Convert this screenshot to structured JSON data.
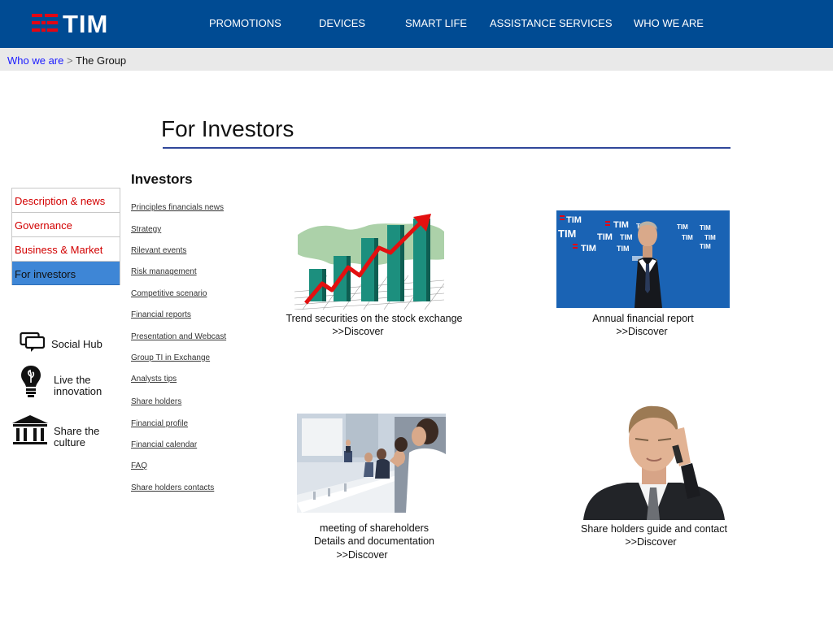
{
  "header": {
    "logo_text": "TIM",
    "brand_color": "#004b93",
    "logo_accent": "#e30613",
    "nav": [
      "PROMOTIONS",
      "DEVICES",
      "SMART LIFE",
      "ASSISTANCE SERVICES",
      "WHO WE ARE"
    ]
  },
  "breadcrumb": {
    "link": "Who we are",
    "separator": ">",
    "current": "The Group"
  },
  "main": {
    "title": "For Investors"
  },
  "leftnav": {
    "items": [
      {
        "label": "Description & news"
      },
      {
        "label": "Governance"
      },
      {
        "label": "Business & Market"
      },
      {
        "label": "For investors",
        "active": true
      }
    ],
    "active_color": "#3e86d6",
    "link_color": "#d20000"
  },
  "social": [
    {
      "label": "Social Hub",
      "icon": "chat-bubbles-icon"
    },
    {
      "label": "Live the\ninnovation",
      "icon": "lightbulb-icon"
    },
    {
      "label": "Share the\n culture",
      "icon": "museum-icon"
    }
  ],
  "investors": {
    "heading": "Investors",
    "links": [
      "Principles financials news",
      "Strategy",
      "Rilevant events",
      "Risk management",
      "Competitive scenario",
      "Financial reports",
      "Presentation and Webcast",
      "Group TI in Exchange",
      "Analysts tips",
      "Share holders",
      "Financial profile",
      "Financial calendar",
      "FAQ",
      "Share holders contacts"
    ]
  },
  "cards": [
    {
      "title": "Trend securities on the stock exchange",
      "discover": ">>Discover",
      "image": "stock-chart-image"
    },
    {
      "title": "Annual financial report",
      "discover": ">>Discover",
      "image": "speaker-photo"
    },
    {
      "title": "meeting of shareholders",
      "subtitle": "Details and documentation",
      "discover": ">>Discover",
      "image": "meeting-photo"
    },
    {
      "title": "Share holders guide and contact",
      "discover": ">>Discover",
      "image": "phone-man-photo"
    }
  ]
}
